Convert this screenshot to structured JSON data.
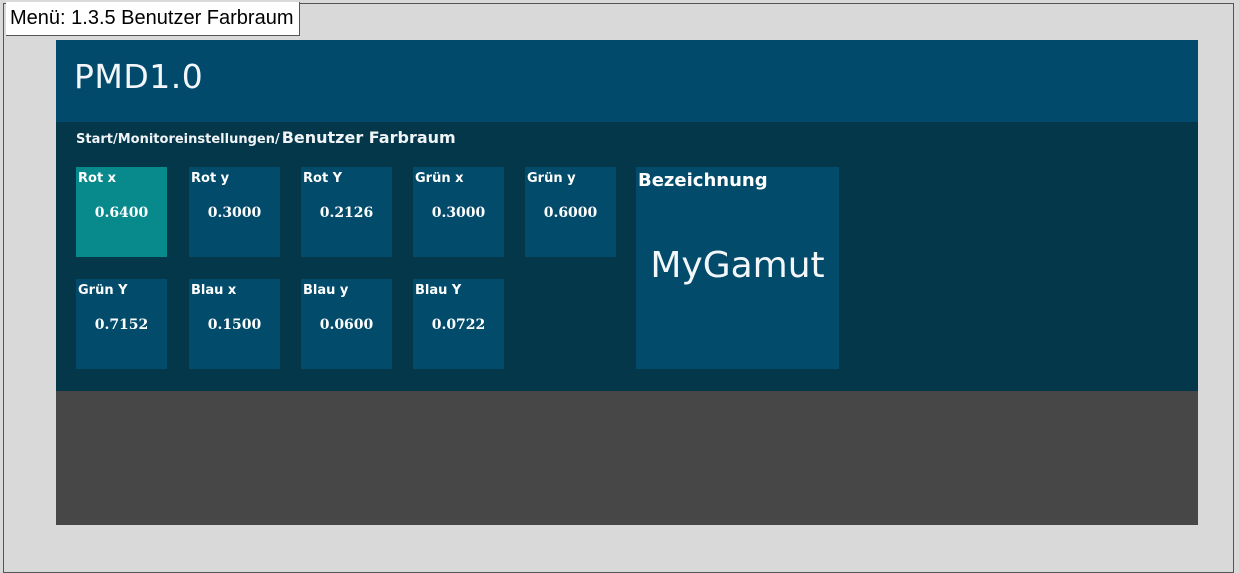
{
  "window": {
    "caption": "Menü: 1.3.5 Benutzer Farbraum"
  },
  "header": {
    "title": "PMD1.0"
  },
  "breadcrumb": {
    "path": "Start/Monitoreinstellungen/",
    "current": "Benutzer Farbraum"
  },
  "tiles": [
    {
      "label": "Rot x",
      "value": "0.6400",
      "selected": true
    },
    {
      "label": "Rot y",
      "value": "0.3000"
    },
    {
      "label": "Rot Y",
      "value": "0.2126"
    },
    {
      "label": "Grün x",
      "value": "0.3000"
    },
    {
      "label": "Grün y",
      "value": "0.6000"
    },
    {
      "label": "Grün Y",
      "value": "0.7152"
    },
    {
      "label": "Blau x",
      "value": "0.1500"
    },
    {
      "label": "Blau y",
      "value": "0.0600"
    },
    {
      "label": "Blau Y",
      "value": "0.0722"
    }
  ],
  "name_tile": {
    "heading": "Bezeichnung",
    "value": "MyGamut"
  },
  "colors": {
    "header_bg": "#024a6b",
    "content_bg": "#033749",
    "tile_bg": "#024b6a",
    "tile_selected_bg": "#08898c",
    "footer_bg": "#474747"
  }
}
